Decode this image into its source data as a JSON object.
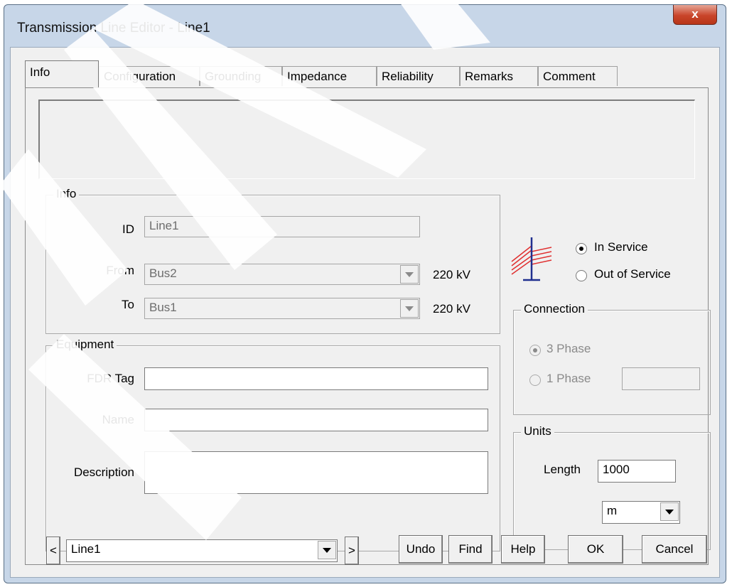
{
  "window": {
    "title": "Transmission Line Editor - Line1",
    "close_glyph": "x"
  },
  "tabs": [
    "Info",
    "Configuration",
    "Grounding",
    "Impedance",
    "Reliability",
    "Remarks",
    "Comment"
  ],
  "info_group": {
    "legend": "Info",
    "id_label": "ID",
    "id_value": "Line1",
    "from_label": "From",
    "from_value": "Bus2",
    "from_kv": "220 kV",
    "to_label": "To",
    "to_value": "Bus1",
    "to_kv": "220 kV"
  },
  "service": {
    "in_service": "In Service",
    "out_of_service": "Out of Service",
    "selected": "in"
  },
  "connection": {
    "legend": "Connection",
    "three_phase": "3 Phase",
    "one_phase": "1 Phase",
    "one_phase_value": ""
  },
  "equipment": {
    "legend": "Equipment",
    "fdr_label": "FDR Tag",
    "fdr_value": "",
    "name_label": "Name",
    "name_value": "",
    "desc_label": "Description",
    "desc_value": ""
  },
  "units": {
    "legend": "Units",
    "length_label": "Length",
    "length_value": "1000",
    "unit_value": "m"
  },
  "footer": {
    "prev": "<",
    "next": ">",
    "selector_value": "Line1",
    "undo": "Undo",
    "find": "Find",
    "help": "Help",
    "ok": "OK",
    "cancel": "Cancel"
  },
  "colors": {
    "tower": "#1f2f8f",
    "wires": "#e03030"
  }
}
